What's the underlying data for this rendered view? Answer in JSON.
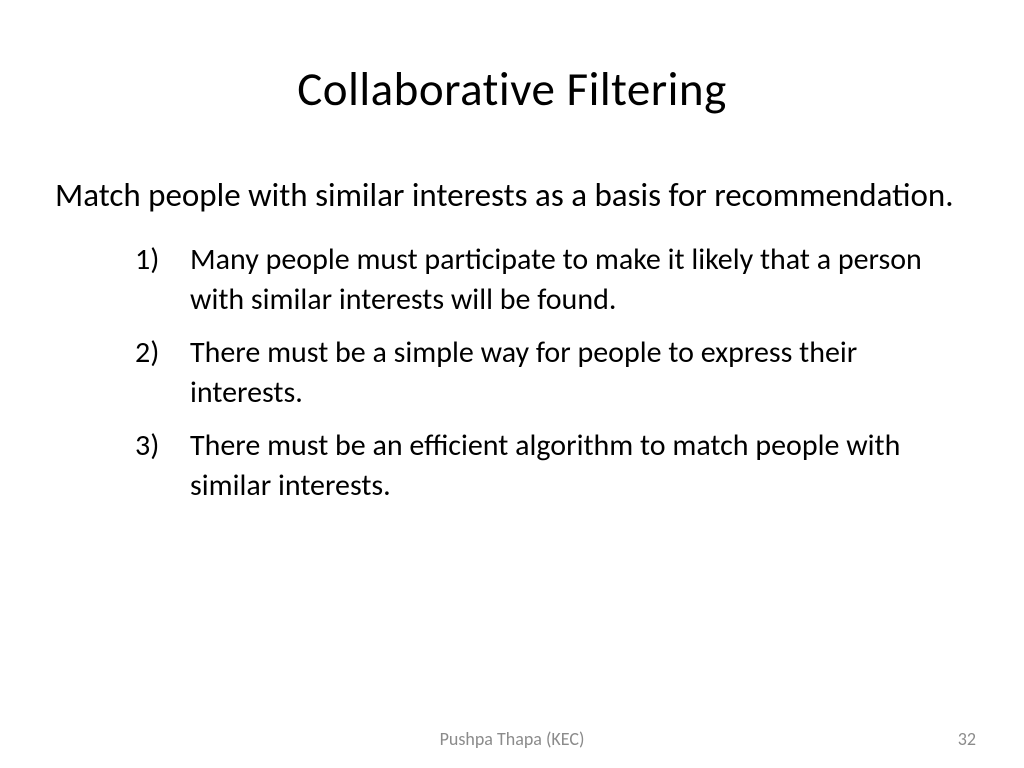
{
  "slide": {
    "title": "Collaborative Filtering",
    "intro": "Match people with similar interests as a basis for recommendation.",
    "items": [
      "Many people must participate to make it likely that a person with similar interests will be found.",
      "There must be a simple way for people to express their interests.",
      "There must be an efficient algorithm to match people with similar interests."
    ]
  },
  "footer": {
    "author": "Pushpa Thapa (KEC)",
    "page_number": "32"
  }
}
